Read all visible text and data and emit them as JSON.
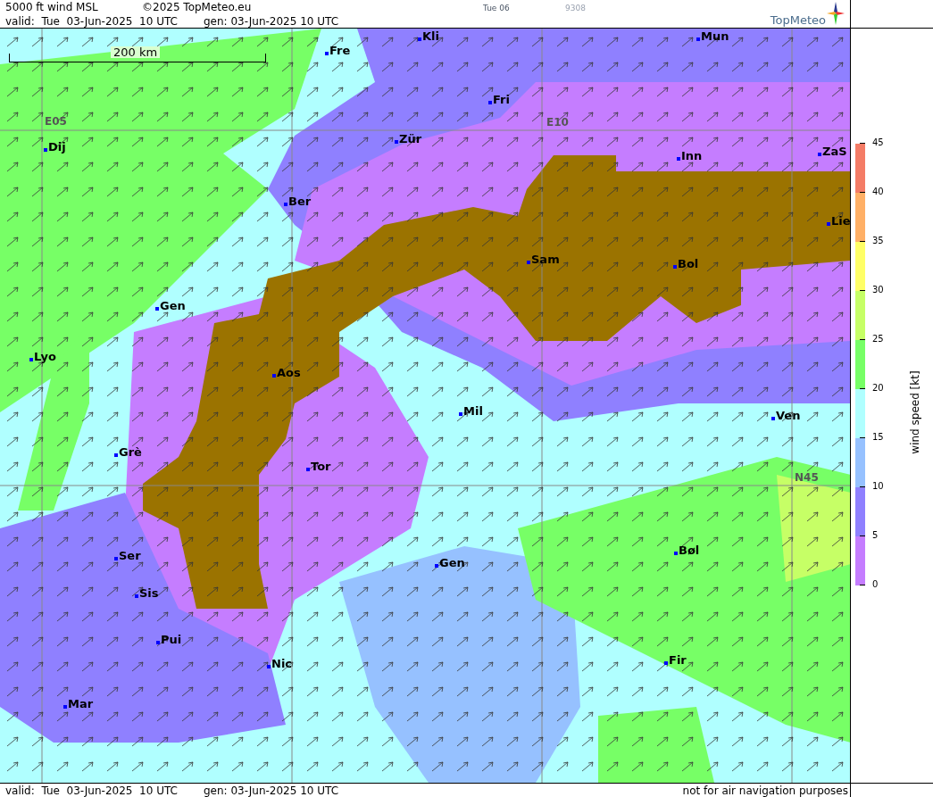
{
  "header": {
    "product": "5000 ft wind MSL",
    "copyright": "©2025 TopMeteo.eu",
    "day": "Tue 06",
    "code": "9308",
    "valid": "valid:  Tue  03-Jun-2025  10 UTC",
    "generated": "gen: 03-Jun-2025 10 UTC",
    "logo": "TopMeteo"
  },
  "map": {
    "scale": "200 km",
    "grid_labels": [
      "E05",
      "E10",
      "N45"
    ],
    "places": [
      "Kli",
      "Mun",
      "Fre",
      "Fri",
      "Dij",
      "Zür",
      "Inn",
      "ZaS",
      "Ber",
      "Lie",
      "Sam",
      "Bol",
      "Gen",
      "Lyo",
      "Aos",
      "Mil",
      "Ven",
      "Grè",
      "Tor",
      "Ser",
      "Gen",
      "Bøl",
      "Sis",
      "Pui",
      "Nic",
      "Fir",
      "Mar"
    ]
  },
  "legend": {
    "title": "wind speed [kt]",
    "ticks": [
      "45",
      "40",
      "35",
      "30",
      "25",
      "20",
      "15",
      "10",
      "5",
      "0"
    ],
    "bands": [
      {
        "color": "#f47c66"
      },
      {
        "color": "#ffb066"
      },
      {
        "color": "#ffff66"
      },
      {
        "color": "#c6ff66"
      },
      {
        "color": "#77ff66"
      },
      {
        "color": "#b0ffff"
      },
      {
        "color": "#96c1ff"
      },
      {
        "color": "#8f80ff"
      },
      {
        "color": "#c57dff"
      }
    ]
  },
  "footer": {
    "valid": "valid:  Tue  03-Jun-2025  10 UTC",
    "generated": "gen: 03-Jun-2025 10 UTC",
    "note": "not for air navigation purposes"
  }
}
